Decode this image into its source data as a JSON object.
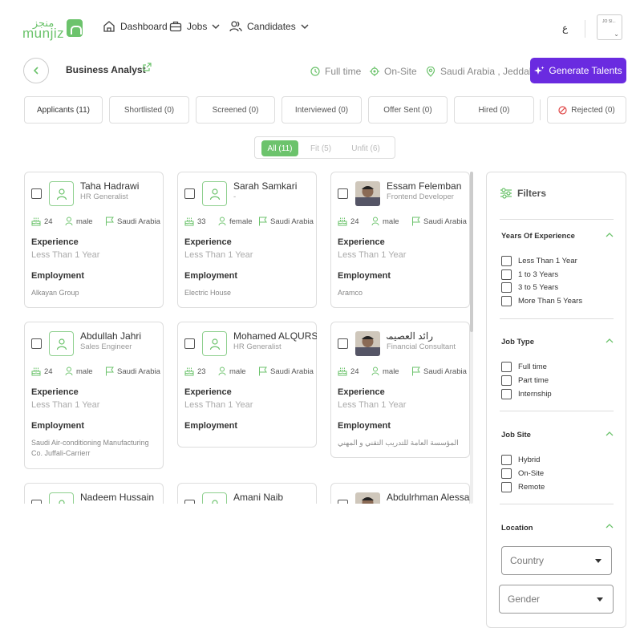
{
  "brand": {
    "logo_text": "munjiz",
    "logo_text_ar": "منجز",
    "color": "#6cc36c"
  },
  "nav": {
    "dashboard": "Dashboard",
    "jobs": "Jobs",
    "candidates": "Candidates",
    "language": "ع",
    "company_logo": "JO SI..."
  },
  "job": {
    "title": "Business Analyst",
    "type": "Full time",
    "site": "On-Site",
    "location": "Saudi Arabia , Jeddah",
    "generate_button": "Generate Talents"
  },
  "tabs": [
    {
      "label": "Applicants (11)"
    },
    {
      "label": "Shortlisted (0)"
    },
    {
      "label": "Screened (0)"
    },
    {
      "label": "Interviewed (0)"
    },
    {
      "label": "Offer Sent (0)"
    },
    {
      "label": "Hired (0)"
    },
    {
      "label": "Rejected (0)"
    }
  ],
  "fit_filter": {
    "all": "All (11)",
    "fit": "Fit (5)",
    "unfit": "Unfit (6)"
  },
  "labels": {
    "experience": "Experience",
    "employment": "Employment"
  },
  "candidates": [
    {
      "name": "Taha Hadrawi",
      "role": "HR Generalist",
      "age": "24",
      "gender": "male",
      "country": "Saudi Arabia",
      "experience": "Less Than 1 Year",
      "employment": "Alkayan Group",
      "photo": false
    },
    {
      "name": "Sarah Samkari",
      "role": "-",
      "age": "33",
      "gender": "female",
      "country": "Saudi Arabia",
      "experience": "Less Than 1 Year",
      "employment": "Electric House",
      "photo": false
    },
    {
      "name": "Essam Felemban",
      "role": "Frontend Developer",
      "age": "24",
      "gender": "male",
      "country": "Saudi Arabia",
      "experience": "Less Than 1 Year",
      "employment": "Aramco",
      "photo": true
    },
    {
      "name": "Abdullah Jahri",
      "role": "Sales Engineer",
      "age": "24",
      "gender": "male",
      "country": "Saudi Arabia",
      "experience": "Less Than 1 Year",
      "employment": "Saudi Air-conditioning Manufacturing Co. Juffali-Carrierr",
      "photo": false
    },
    {
      "name": "Mohamed ALQURSHI",
      "role": "HR Generalist",
      "age": "23",
      "gender": "male",
      "country": "Saudi Arabia",
      "experience": "Less Than 1 Year",
      "employment": "",
      "photo": false
    },
    {
      "name": "رائد العصيمي",
      "role": "Financial Consultant",
      "age": "24",
      "gender": "male",
      "country": "Saudi Arabia",
      "experience": "Less Than 1 Year",
      "employment": "المؤسسة العامة للتدريب التقني و المهني",
      "photo": true
    },
    {
      "name": "Nadeem Hussain",
      "photo": false
    },
    {
      "name": "Amani Naib",
      "photo": false
    },
    {
      "name": "Abdulrhman Alessa",
      "photo": true
    }
  ],
  "filters": {
    "title": "Filters",
    "years": {
      "title": "Years Of Experience",
      "options": [
        "Less Than 1 Year",
        "1 to 3 Years",
        "3 to 5 Years",
        "More Than 5 Years"
      ]
    },
    "job_type": {
      "title": "Job Type",
      "options": [
        "Full time",
        "Part time",
        "Internship"
      ]
    },
    "job_site": {
      "title": "Job Site",
      "options": [
        "Hybrid",
        "On-Site",
        "Remote"
      ]
    },
    "location": {
      "title": "Location",
      "country_placeholder": "Country",
      "gender_placeholder": "Gender"
    }
  },
  "colors": {
    "accent": "#6a2be0",
    "green": "#6cc36c"
  }
}
